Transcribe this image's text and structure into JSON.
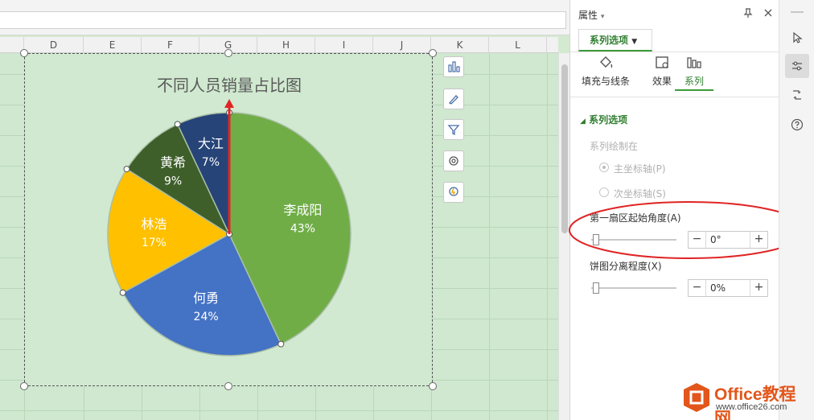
{
  "sheet": {
    "columns": [
      "D",
      "E",
      "F",
      "G",
      "H",
      "I",
      "J",
      "K",
      "L"
    ]
  },
  "chart": {
    "tools": [
      "chart-elements-icon",
      "chart-style-icon",
      "chart-filter-icon",
      "chart-settings-icon",
      "chart-ideas-icon"
    ]
  },
  "chart_data": {
    "type": "pie",
    "title": "不同人员销量占比图",
    "start_angle_deg": 0,
    "slices": [
      {
        "label": "李成阳",
        "value": 43,
        "value_label": "43%",
        "color": "#70ad47"
      },
      {
        "label": "何勇",
        "value": 24,
        "value_label": "24%",
        "color": "#4472c4"
      },
      {
        "label": "林浩",
        "value": 17,
        "value_label": "17%",
        "color": "#ffc000"
      },
      {
        "label": "黄希",
        "value": 9,
        "value_label": "9%",
        "color": "#3e5f2a"
      },
      {
        "label": "大江",
        "value": 7,
        "value_label": "7%",
        "color": "#264478"
      }
    ]
  },
  "panel": {
    "title": "属性",
    "tab_label": "系列选项",
    "subtabs": {
      "fill": "填充与线条",
      "effect": "效果",
      "series": "系列"
    },
    "section_title": "系列选项",
    "plot_on_label": "系列绘制在",
    "primary_axis": "主坐标轴(P)",
    "secondary_axis": "次坐标轴(S)",
    "first_slice_angle": {
      "label": "第一扇区起始角度(A)",
      "value": "0°",
      "slider": 0
    },
    "explosion": {
      "label": "饼图分离程度(X)",
      "value": "0%",
      "slider": 0
    },
    "accent_color": "#3c9b3a",
    "highlight_color": "#e02424"
  },
  "watermark": {
    "brand": "Office教程网",
    "url": "www.office26.com"
  }
}
